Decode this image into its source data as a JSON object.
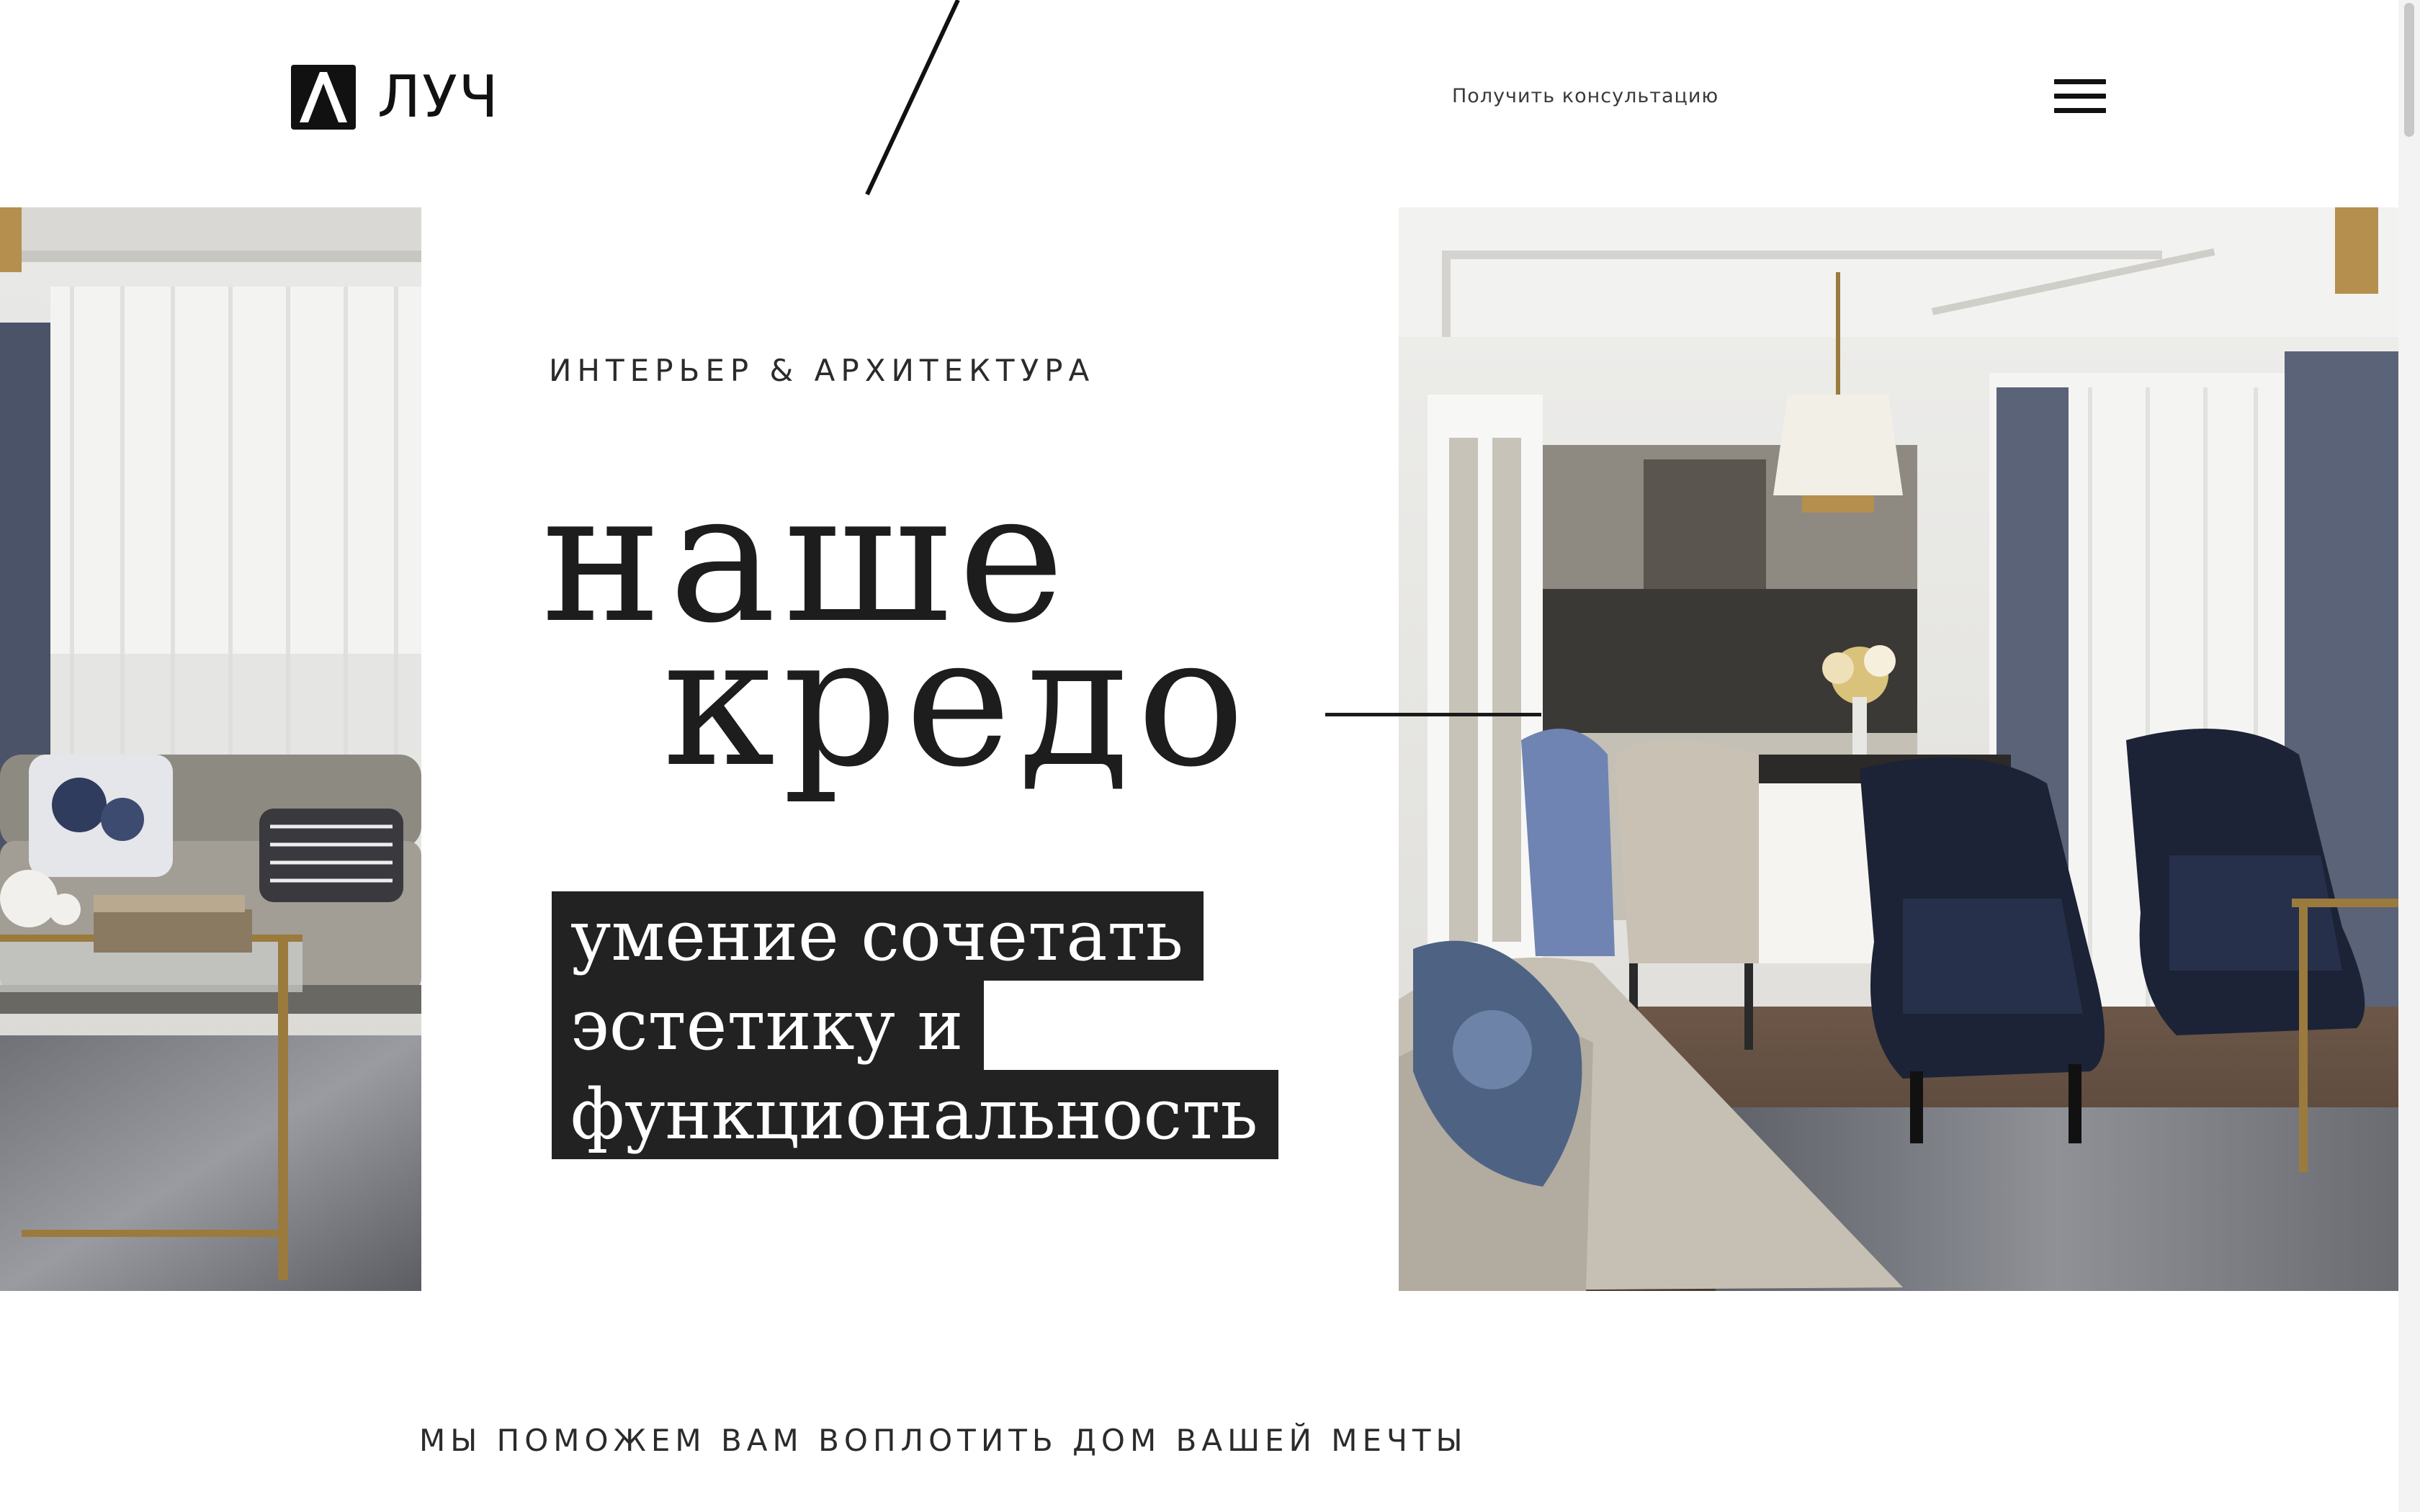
{
  "header": {
    "logo_text": "ЛУЧ",
    "consult_link": "Получить консультацию"
  },
  "hero": {
    "kicker": "ИНТЕРЬЕР & АРХИТЕКТУРА",
    "headline_line1": "наше",
    "headline_line2": "кредо",
    "tagline": [
      "умение сочетать",
      "эстетику и",
      "функциональность"
    ]
  },
  "section": {
    "subtitle": "МЫ ПОМОЖЕМ ВАМ ВОПЛОТИТЬ ДОМ ВАШЕЙ МЕЧТЫ"
  },
  "colors": {
    "text": "#222222",
    "tag_background": "#222222",
    "background": "#ffffff"
  },
  "icons": [
    "logo-mark-icon",
    "menu-icon"
  ]
}
